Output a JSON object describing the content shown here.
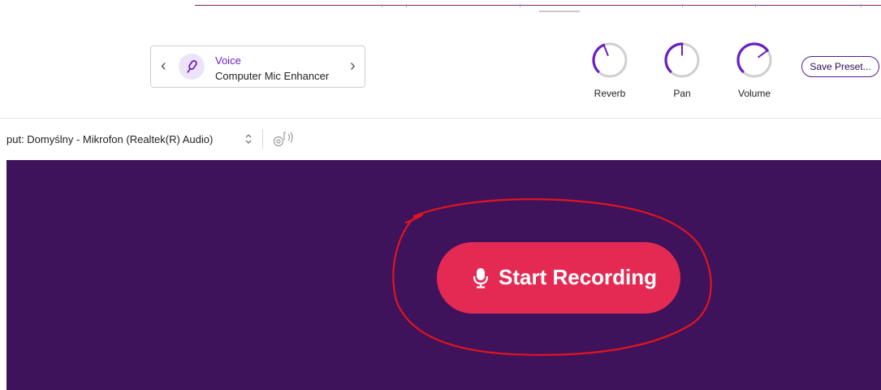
{
  "preset": {
    "category": "Voice",
    "name": "Computer Mic Enhancer",
    "prev_icon": "chevron-left-icon",
    "next_icon": "chevron-right-icon",
    "mic_icon": "microphone-icon"
  },
  "knobs": [
    {
      "label": "Reverb",
      "level": 0.42
    },
    {
      "label": "Pan",
      "level": 0.5
    },
    {
      "label": "Volume",
      "level": 0.7
    }
  ],
  "save_preset_label": "Save Preset...",
  "input": {
    "label": "put: Domyślny - Mikrofon (Realtek(R) Audio)",
    "stepper_icon": "up-down-chevron-icon",
    "monitor_icon": "speaker-monitor-icon"
  },
  "recording": {
    "label": "Start Recording",
    "icon": "microphone-icon"
  },
  "colors": {
    "accent_purple": "#6b1fc2",
    "stage_background": "#3f135c",
    "record_button": "#e42a53",
    "annotation_red": "#e0141e"
  }
}
